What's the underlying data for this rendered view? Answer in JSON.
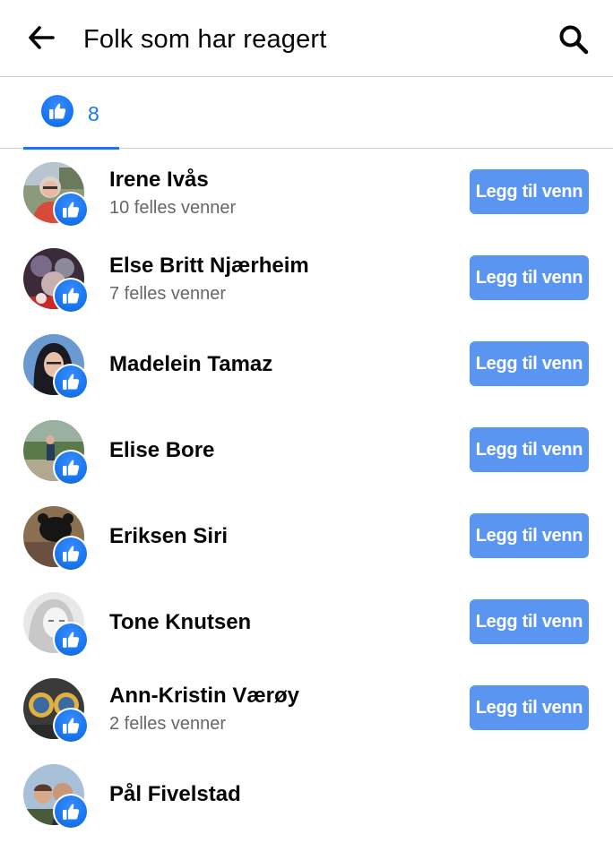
{
  "header": {
    "title": "Folk som har reagert"
  },
  "tabs": [
    {
      "reaction": "like-icon",
      "count": "8"
    }
  ],
  "add_friend_label": "Legg til venn",
  "colors": {
    "accent": "#1877f2",
    "button": "#5b95f2"
  },
  "people": [
    {
      "name": "Irene Ivås",
      "mutual": "10 felles venner",
      "has_button": true
    },
    {
      "name": "Else Britt Njærheim",
      "mutual": "7 felles venner",
      "has_button": true
    },
    {
      "name": "Madelein Tamaz",
      "mutual": "",
      "has_button": true
    },
    {
      "name": "Elise Bore",
      "mutual": "",
      "has_button": true
    },
    {
      "name": "Eriksen Siri",
      "mutual": "",
      "has_button": true
    },
    {
      "name": "Tone Knutsen",
      "mutual": "",
      "has_button": true
    },
    {
      "name": "Ann-Kristin Værøy",
      "mutual": "2 felles venner",
      "has_button": true
    },
    {
      "name": "Pål Fivelstad",
      "mutual": "",
      "has_button": false
    }
  ]
}
